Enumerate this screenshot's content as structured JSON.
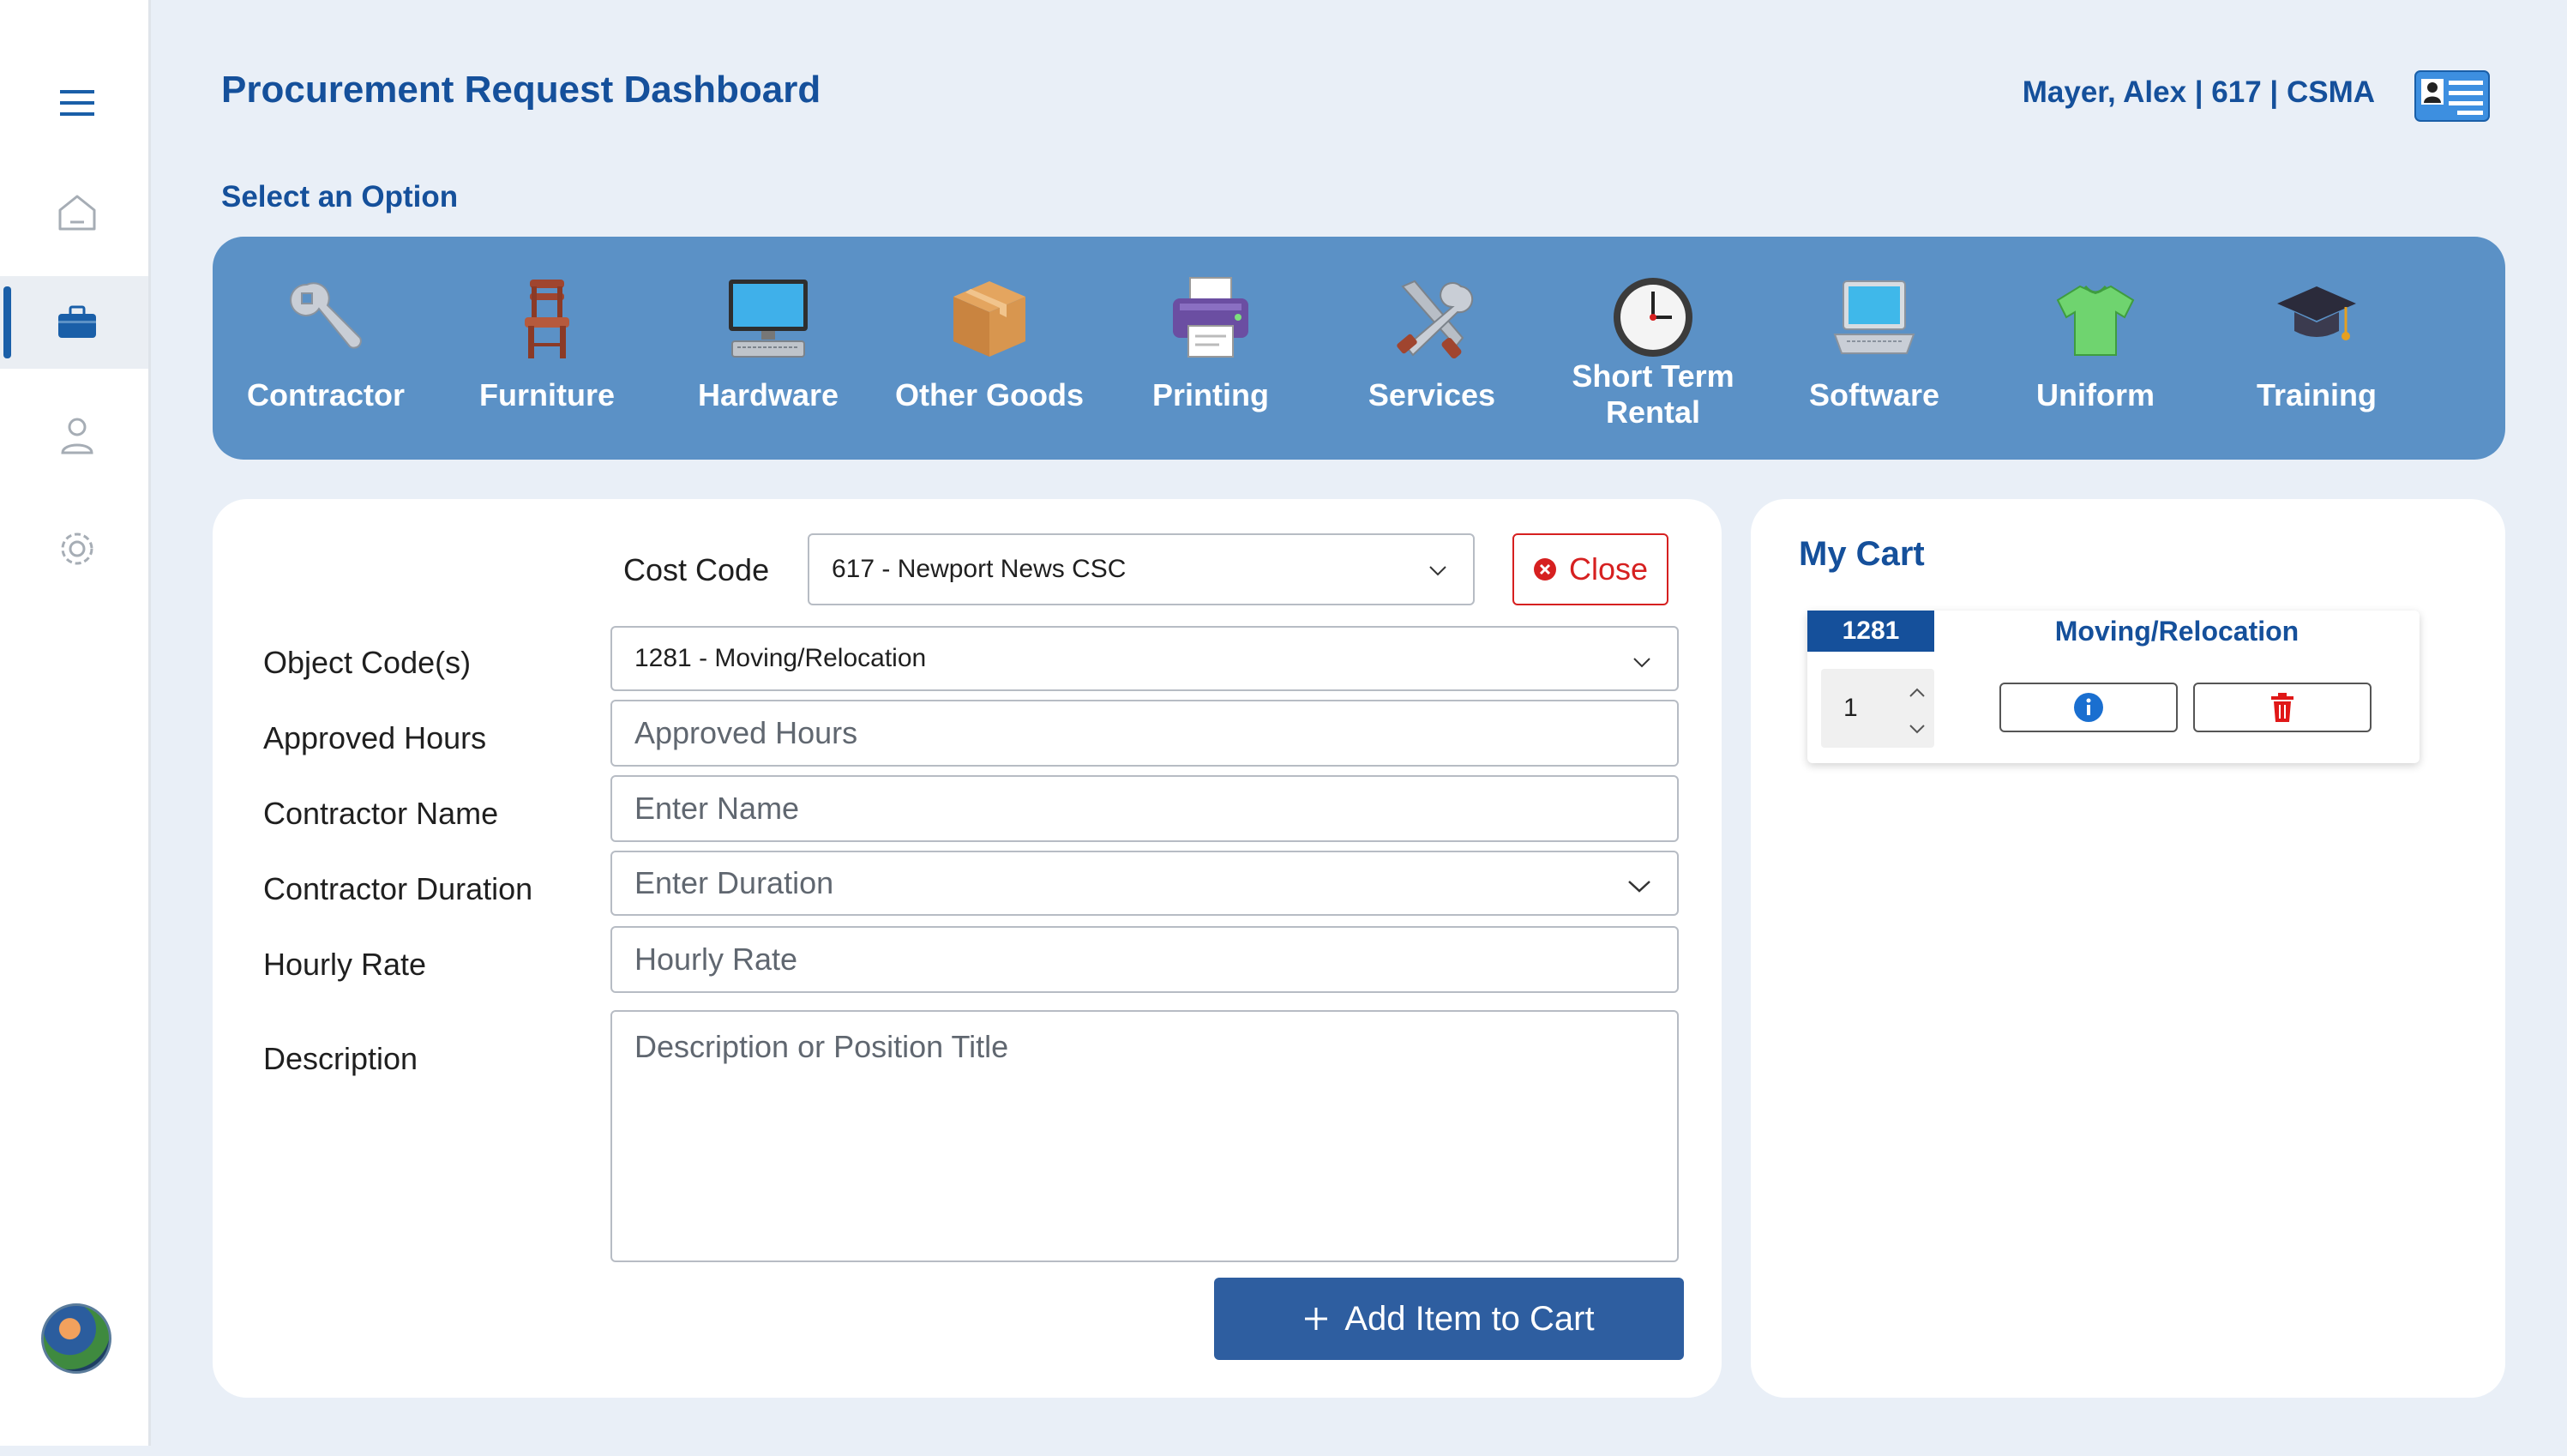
{
  "header": {
    "title": "Procurement Request Dashboard",
    "user": "Mayer, Alex | 617 | CSMA",
    "select_option": "Select an Option"
  },
  "sidebar": {
    "items": [
      {
        "name": "menu-icon"
      },
      {
        "name": "home-icon"
      },
      {
        "name": "briefcase-icon",
        "active": true
      },
      {
        "name": "user-icon"
      },
      {
        "name": "gear-icon"
      }
    ]
  },
  "categories": [
    {
      "label": "Contractor",
      "icon": "wrench-icon"
    },
    {
      "label": "Furniture",
      "icon": "chair-icon"
    },
    {
      "label": "Hardware",
      "icon": "monitor-icon"
    },
    {
      "label": "Other Goods",
      "icon": "box-icon"
    },
    {
      "label": "Printing",
      "icon": "printer-icon"
    },
    {
      "label": "Services",
      "icon": "tools-icon"
    },
    {
      "label": "Short Term Rental",
      "icon": "clock-icon"
    },
    {
      "label": "Software",
      "icon": "laptop-icon"
    },
    {
      "label": "Uniform",
      "icon": "shirt-icon"
    },
    {
      "label": "Training",
      "icon": "graduation-cap-icon"
    }
  ],
  "form": {
    "cost_code_label": "Cost Code",
    "cost_code_value": "617 - Newport News CSC",
    "close_label": "Close",
    "object_code_label": "Object Code(s)",
    "object_code_value": "1281 - Moving/Relocation",
    "approved_hours_label": "Approved Hours",
    "approved_hours_placeholder": "Approved Hours",
    "contractor_name_label": "Contractor Name",
    "contractor_name_placeholder": "Enter Name",
    "contractor_duration_label": "Contractor Duration",
    "contractor_duration_placeholder": "Enter Duration",
    "hourly_rate_label": "Hourly Rate",
    "hourly_rate_placeholder": "Hourly Rate",
    "description_label": "Description",
    "description_placeholder": "Description or Position Title",
    "add_button_label": "Add Item to Cart"
  },
  "cart": {
    "title": "My Cart",
    "items": [
      {
        "code": "1281",
        "name": "Moving/Relocation",
        "quantity": "1"
      }
    ]
  },
  "colors": {
    "accent": "#15509b",
    "band": "#5b91c6",
    "button": "#2e5ea0",
    "danger": "#d62020"
  }
}
